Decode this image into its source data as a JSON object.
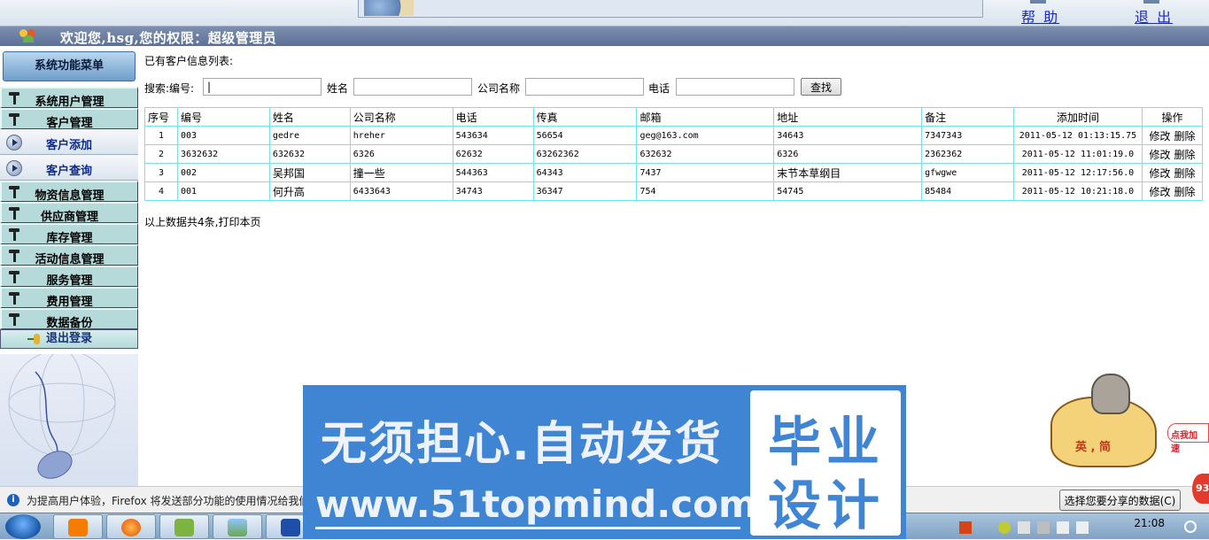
{
  "header": {
    "help_label": "帮 助",
    "logout_label": "退 出",
    "welcome_text": "欢迎您,hsg,您的权限：超级管理员"
  },
  "sidebar": {
    "menu_title": "系统功能菜单",
    "items": [
      {
        "label": "系统用户管理"
      },
      {
        "label": "客户管理"
      },
      {
        "label": "客户添加"
      },
      {
        "label": "客户查询"
      },
      {
        "label": "物资信息管理"
      },
      {
        "label": "供应商管理"
      },
      {
        "label": "库存管理"
      },
      {
        "label": "活动信息管理"
      },
      {
        "label": "服务管理"
      },
      {
        "label": "费用管理"
      },
      {
        "label": "数据备份"
      }
    ],
    "logout_label": "退出登录"
  },
  "main": {
    "list_title": "已有客户信息列表:",
    "search": {
      "label_prefix": "搜索:编号:",
      "label_name": "姓名",
      "label_company": "公司名称",
      "label_phone": "电话",
      "id_value": "|",
      "button_label": "查找"
    },
    "table": {
      "headers": [
        "序号",
        "编号",
        "姓名",
        "公司名称",
        "电话",
        "传真",
        "邮箱",
        "地址",
        "备注",
        "添加时间",
        "操作"
      ],
      "rows": [
        {
          "seq": "1",
          "id": "003",
          "name": "gedre",
          "company": "hreher",
          "phone": "543634",
          "fax": "56654",
          "email": "geg@163.com",
          "address": "34643",
          "note": "7347343",
          "time": "2011-05-12 01:13:15.75"
        },
        {
          "seq": "2",
          "id": "3632632",
          "name": "632632",
          "company": "6326",
          "phone": "62632",
          "fax": "63262362",
          "email": "632632",
          "address": "6326",
          "note": "2362362",
          "time": "2011-05-12 11:01:19.0"
        },
        {
          "seq": "3",
          "id": "002",
          "name": "吴邦国",
          "company": "撞一些",
          "phone": "544363",
          "fax": "64343",
          "email": "7437",
          "address": "末节本草纲目",
          "note": "gfwgwe",
          "time": "2011-05-12 12:17:56.0"
        },
        {
          "seq": "4",
          "id": "001",
          "name": "何升高",
          "company": "6433643",
          "phone": "34743",
          "fax": "36347",
          "email": "754",
          "address": "54745",
          "note": "85484",
          "time": "2011-05-12 10:21:18.0"
        }
      ],
      "edit_label": "修改",
      "delete_label": "删除"
    },
    "summary": "以上数据共4条,打印本页"
  },
  "notification": {
    "message": "为提高用户体验，Firefox 将发送部分功能的使用情况给我们",
    "choose_button": "选择您要分享的数据(C)"
  },
  "ad": {
    "line1": "无须担心.自动发货",
    "line2": "www.51topmind.com",
    "badge_top": "毕业",
    "badge_bottom": "设计"
  },
  "overlay": {
    "mascot_tag": "英 , 简",
    "speed_label": "点我加速",
    "red_badge": "93"
  },
  "taskbar": {
    "clock": "21:08"
  }
}
